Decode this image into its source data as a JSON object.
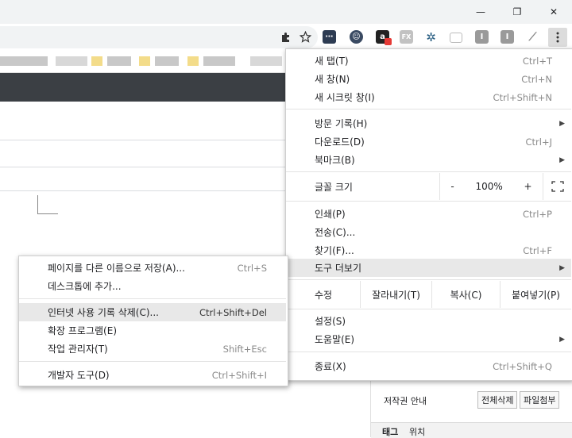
{
  "browser": {
    "window_controls": {
      "minimize": "—",
      "maximize": "❐",
      "close": "✕"
    },
    "toolbar_icons": [
      "puzzle-icon",
      "star-icon",
      "more-icon"
    ],
    "extensions": [
      {
        "name": "ext-dots-icon",
        "color": "#2d3b52",
        "label": "⋯"
      },
      {
        "name": "ext-smile-icon",
        "color": "#3a4a62",
        "label": "☺"
      },
      {
        "name": "ext-a-icon",
        "color": "#222222",
        "label": "a"
      },
      {
        "name": "ext-fx-icon",
        "color": "#b8b8b8",
        "label": "FX"
      },
      {
        "name": "ext-gear-icon",
        "color": "#2a5f83",
        "label": "✲"
      },
      {
        "name": "ext-window-icon",
        "color": "#c8c8c8",
        "label": ""
      },
      {
        "name": "ext-i1-icon",
        "color": "#9a9a9a",
        "label": "I"
      },
      {
        "name": "ext-i2-icon",
        "color": "#9a9a9a",
        "label": "I"
      },
      {
        "name": "ext-tag-icon",
        "color": "#d0d0d0",
        "label": "⟋"
      }
    ]
  },
  "menu": {
    "new_tab": {
      "label": "새 탭(T)",
      "shortcut": "Ctrl+T"
    },
    "new_window": {
      "label": "새 창(N)",
      "shortcut": "Ctrl+N"
    },
    "incognito": {
      "label": "새 시크릿 창(I)",
      "shortcut": "Ctrl+Shift+N"
    },
    "history": {
      "label": "방문 기록(H)"
    },
    "downloads": {
      "label": "다운로드(D)",
      "shortcut": "Ctrl+J"
    },
    "bookmarks": {
      "label": "북마크(B)"
    },
    "zoom": {
      "label": "글꼴 크기",
      "minus": "-",
      "value": "100%",
      "plus": "+"
    },
    "print": {
      "label": "인쇄(P)",
      "shortcut": "Ctrl+P"
    },
    "cast": {
      "label": "전송(C)..."
    },
    "find": {
      "label": "찾기(F)...",
      "shortcut": "Ctrl+F"
    },
    "more_tools": {
      "label": "도구 더보기"
    },
    "edit": {
      "label": "수정",
      "cut": "잘라내기(T)",
      "copy": "복사(C)",
      "paste": "붙여넣기(P)"
    },
    "settings": {
      "label": "설정(S)"
    },
    "help": {
      "label": "도움말(E)"
    },
    "exit": {
      "label": "종료(X)",
      "shortcut": "Ctrl+Shift+Q"
    }
  },
  "submenu": {
    "save_page": {
      "label": "페이지를 다른 이름으로 저장(A)...",
      "shortcut": "Ctrl+S"
    },
    "add_to_desktop": {
      "label": "데스크톱에 추가..."
    },
    "clear_data": {
      "label": "인터넷 사용 기록 삭제(C)...",
      "shortcut": "Ctrl+Shift+Del"
    },
    "extensions": {
      "label": "확장 프로그램(E)"
    },
    "task_manager": {
      "label": "작업 관리자(T)",
      "shortcut": "Shift+Esc"
    },
    "dev_tools": {
      "label": "개발자 도구(D)",
      "shortcut": "Ctrl+Shift+I"
    }
  },
  "page": {
    "copyright": "저작권 안내",
    "delete_all": "전체삭제",
    "attach_file": "파일첨부",
    "tag": "태그",
    "location": "위치"
  }
}
